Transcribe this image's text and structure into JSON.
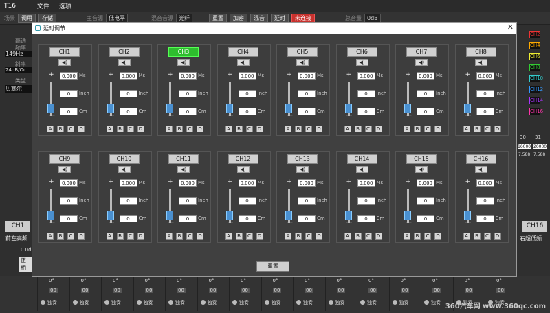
{
  "window": {
    "title": "T16",
    "menu": [
      "文件",
      "选项"
    ]
  },
  "toolbar": {
    "scene_label": "场景",
    "call_btn": "调用",
    "save_btn": "存储",
    "source_label": "主音源",
    "source_value": "低电平",
    "mix_label": "混音音源",
    "mix_value": "光纤",
    "reset_btn": "重置",
    "encrypt_btn": "加密",
    "mute_btn": "混音",
    "delay_btn": "延时",
    "status_btn": "未连接",
    "vol_label": "总音量",
    "vol_value": "0dB"
  },
  "dialog": {
    "title": "延时调节",
    "reset_label": "重置"
  },
  "units": {
    "ms": "Ms",
    "inch": "Inch",
    "cm": "Cm"
  },
  "ab": [
    "A",
    "B",
    "C",
    "D"
  ],
  "channels": [
    {
      "name": "CH1",
      "ms": "0.000",
      "inch": "0",
      "cm": "0"
    },
    {
      "name": "CH2",
      "ms": "0.000",
      "inch": "0",
      "cm": "0"
    },
    {
      "name": "CH3",
      "ms": "0.000",
      "inch": "0",
      "cm": "0"
    },
    {
      "name": "CH4",
      "ms": "0.000",
      "inch": "0",
      "cm": "0"
    },
    {
      "name": "CH5",
      "ms": "0.000",
      "inch": "0",
      "cm": "0"
    },
    {
      "name": "CH6",
      "ms": "0.000",
      "inch": "0",
      "cm": "0"
    },
    {
      "name": "CH7",
      "ms": "0.000",
      "inch": "0",
      "cm": "0"
    },
    {
      "name": "CH8",
      "ms": "0.000",
      "inch": "0",
      "cm": "0"
    },
    {
      "name": "CH9",
      "ms": "0.000",
      "inch": "0",
      "cm": "0"
    },
    {
      "name": "CH10",
      "ms": "0.000",
      "inch": "0",
      "cm": "0"
    },
    {
      "name": "CH11",
      "ms": "0.000",
      "inch": "0",
      "cm": "0"
    },
    {
      "name": "CH12",
      "ms": "0.000",
      "inch": "0",
      "cm": "0"
    },
    {
      "name": "CH13",
      "ms": "0.000",
      "inch": "0",
      "cm": "0"
    },
    {
      "name": "CH14",
      "ms": "0.000",
      "inch": "0",
      "cm": "0"
    },
    {
      "name": "CH15",
      "ms": "0.000",
      "inch": "0",
      "cm": "0"
    },
    {
      "name": "CH16",
      "ms": "0.000",
      "inch": "0",
      "cm": "0"
    }
  ],
  "left": {
    "hp": "高通",
    "freq_label": "频率",
    "freq": "149Hz",
    "slope_label": "斜率",
    "slope": "24dB/Oc",
    "type_label": "类型",
    "type": "贝塞尔",
    "ch": "CH1",
    "ch_desc": "前左高频",
    "gain": "0.0dB",
    "phase": "正相",
    "deg": "0°"
  },
  "right": {
    "ch": "CH16",
    "ch_desc": "右超低频",
    "tags": [
      "CH2",
      "CH4",
      "CH6",
      "CH8",
      "CH10",
      "CH12",
      "CH14",
      "CH16"
    ],
    "v1": "30",
    "v2": "31",
    "v3": "16000",
    "v4": "20000",
    "v5": "7.588",
    "v6": "7.588"
  },
  "bottom": {
    "deg": "0°",
    "oo": "00",
    "solo": "独奏"
  },
  "watermark": "360汽车网 www.360qc.com",
  "colors": {
    "active": "#2ebd2e",
    "status": "#c8322e",
    "accent": "#4a90d0"
  }
}
